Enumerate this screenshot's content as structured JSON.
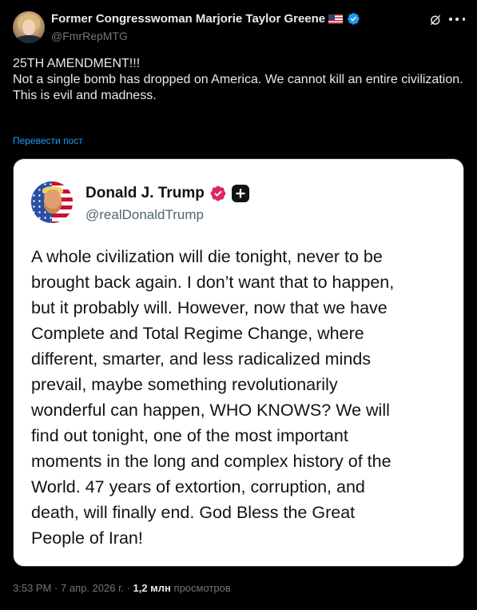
{
  "author": {
    "display_name": "Former Congresswoman Marjorie Taylor Greene",
    "flag_emoji": "us-flag",
    "handle": "@FmrRepMTG",
    "verified_color": "#1d9bf0"
  },
  "post": {
    "lines": [
      "25TH AMENDMENT!!!",
      "Not a single bomb has dropped on America. We cannot kill an entire civilization.",
      "This is evil and madness."
    ],
    "translate_label": "Перевести пост"
  },
  "quoted_image": {
    "name": "Donald J. Trump",
    "handle": "@realDonaldTrump",
    "badge_color": "#e0245e",
    "text_lines": [
      "A whole civilization will die tonight, never to be",
      "brought back again. I don’t want that to happen,",
      "but it probably will. However, now that we have",
      "Complete and Total Regime Change, where",
      "different, smarter, and less radicalized minds",
      "prevail, maybe something revolutionarily",
      "wonderful can happen, WHO KNOWS? We will",
      "find out tonight, one of the most important",
      "moments in the long and complex history of the",
      "World. 47 years of extortion, corruption, and",
      "death, will finally end. God Bless the Great",
      "People of Iran!"
    ]
  },
  "meta": {
    "time": "3:53 PM",
    "separator": "·",
    "date": "7 апр. 2026 г.",
    "views_count": "1,2 млн",
    "views_label": "просмотров"
  },
  "icons": {
    "grok": "grok-icon",
    "more": "more-icon"
  }
}
